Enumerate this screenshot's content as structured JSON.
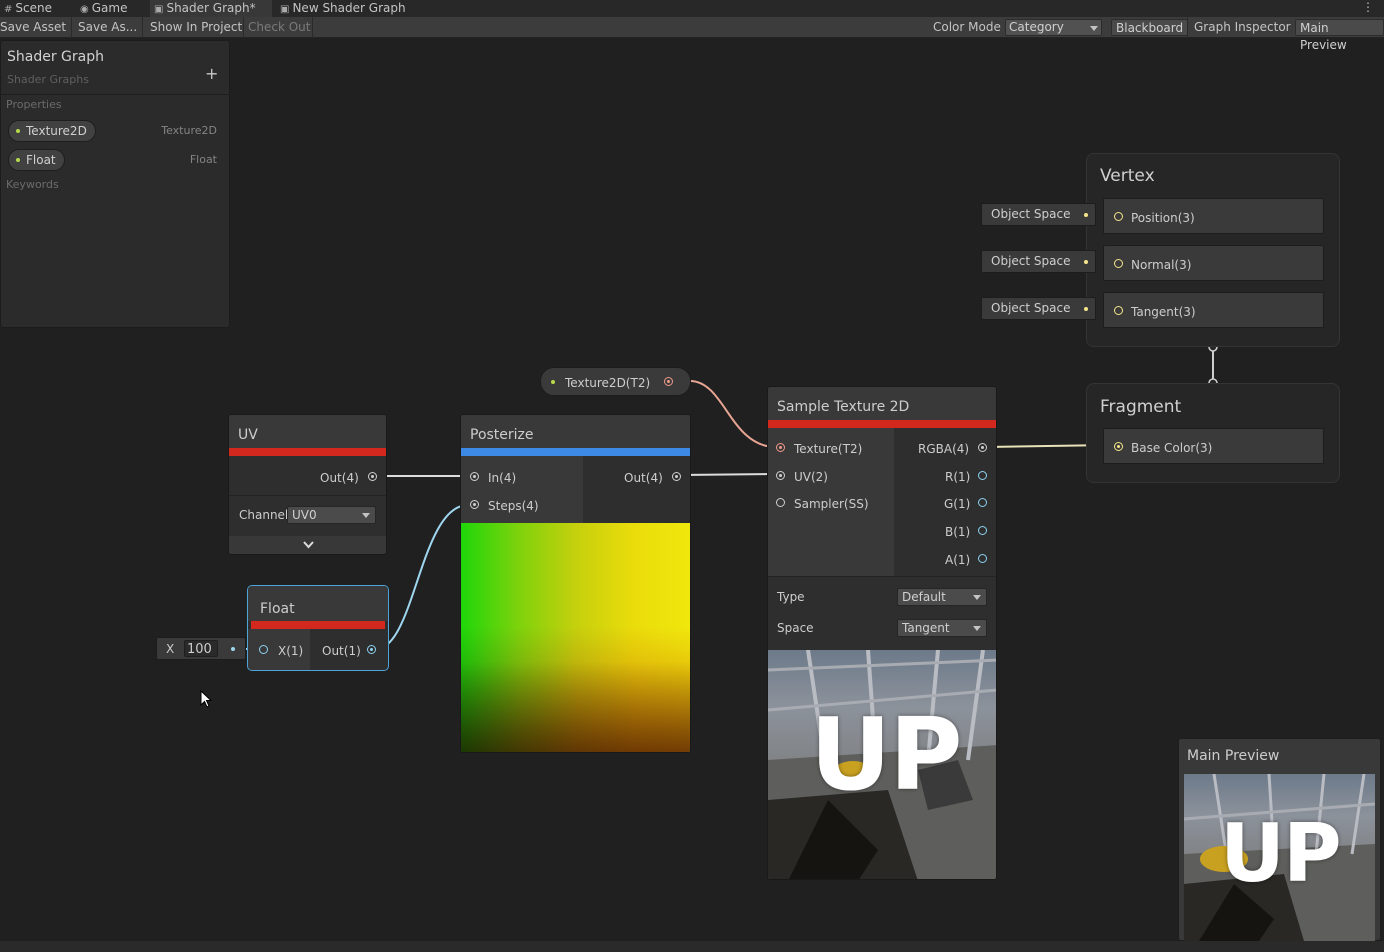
{
  "tabs": [
    {
      "label": "Scene",
      "icon": "grid-icon"
    },
    {
      "label": "Game",
      "icon": "gamepad-icon"
    },
    {
      "label": "Shader Graph*",
      "icon": "shader-graph-icon",
      "active": true
    },
    {
      "label": "New Shader Graph",
      "icon": "shader-graph-icon"
    }
  ],
  "toolbar": {
    "save_asset": "Save Asset",
    "save_as": "Save As...",
    "show_in_project": "Show In Project",
    "check_out": "Check Out",
    "color_mode_label": "Color Mode",
    "color_mode_value": "Category",
    "blackboard": "Blackboard",
    "graph_inspector": "Graph Inspector",
    "main_preview": "Main Preview"
  },
  "blackboard": {
    "title": "Shader Graph",
    "subtitle": "Shader Graphs",
    "properties_label": "Properties",
    "keywords_label": "Keywords",
    "properties": [
      {
        "name": "Texture2D",
        "type": "Texture2D"
      },
      {
        "name": "Float",
        "type": "Float"
      }
    ]
  },
  "nodes": {
    "uv": {
      "title": "UV",
      "out": "Out(4)",
      "channel_label": "Channel",
      "channel_value": "UV0"
    },
    "float": {
      "title": "Float",
      "x_label": "X",
      "x_value": "100",
      "in": "X(1)",
      "out": "Out(1)"
    },
    "posterize": {
      "title": "Posterize",
      "in": "In(4)",
      "steps": "Steps(4)",
      "out": "Out(4)"
    },
    "texture_prop": {
      "label": "Texture2D(T2)"
    },
    "sample": {
      "title": "Sample Texture 2D",
      "inputs": [
        "Texture(T2)",
        "UV(2)",
        "Sampler(SS)"
      ],
      "outputs": [
        "RGBA(4)",
        "R(1)",
        "G(1)",
        "B(1)",
        "A(1)"
      ],
      "type_label": "Type",
      "type_value": "Default",
      "space_label": "Space",
      "space_value": "Tangent",
      "preview_text": "UP"
    }
  },
  "master": {
    "vertex_title": "Vertex",
    "vertex_blocks": [
      {
        "label": "Position(3)",
        "space": "Object Space"
      },
      {
        "label": "Normal(3)",
        "space": "Object Space"
      },
      {
        "label": "Tangent(3)",
        "space": "Object Space"
      }
    ],
    "fragment_title": "Fragment",
    "fragment_blocks": [
      {
        "label": "Base Color(3)"
      }
    ]
  },
  "main_preview": {
    "title": "Main Preview",
    "preview_text": "UP"
  },
  "colors": {
    "uv_bar": "#d2281e",
    "float_bar": "#d2281e",
    "posterize_bar": "#3d8ae6",
    "sample_bar": "#d2281e",
    "selection": "#4fa3d8"
  }
}
